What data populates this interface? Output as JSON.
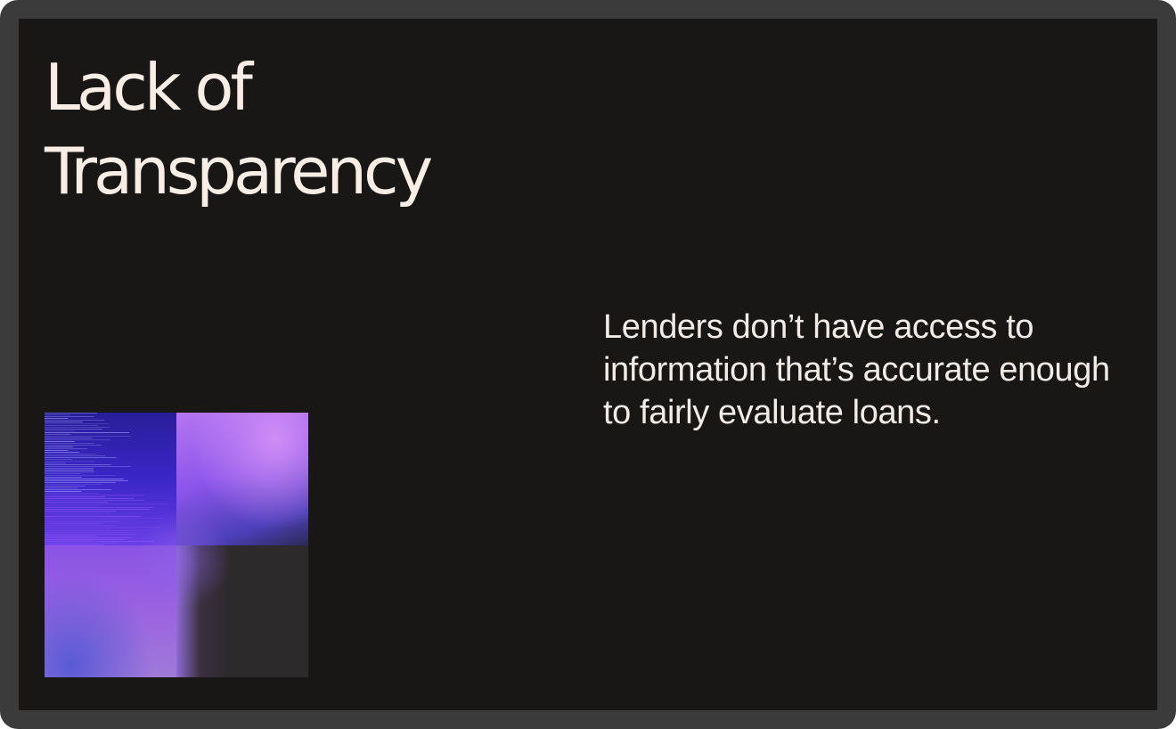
{
  "slide": {
    "title_line1": "Lack of",
    "title_line2": "Transparency",
    "body": "Lenders don’t have access to information that’s accurate enough to fairly evaluate loans."
  },
  "colors": {
    "frame": "#3c3b3b",
    "background": "#181716",
    "title_text": "#f8eee6",
    "body_text": "#f2ece8",
    "accent_purple": "#8a55ea",
    "accent_blue": "#3b26c8"
  }
}
